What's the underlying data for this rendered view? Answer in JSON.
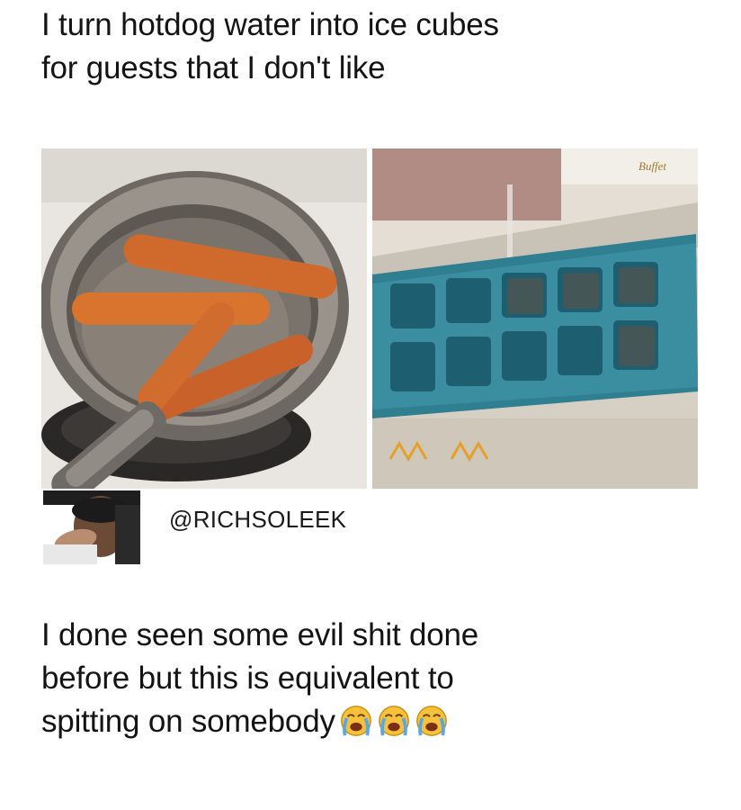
{
  "post": {
    "caption_lines": [
      "I turn hotdog water into ice cubes",
      "for guests that I don't like"
    ]
  },
  "reply": {
    "handle": "@RICHSOLEEK",
    "text_lines": [
      "I done seen some evil shit done",
      "before but this is equivalent to",
      "spitting on somebody"
    ],
    "emoji": [
      "loudly-crying-face-icon",
      "loudly-crying-face-icon",
      "loudly-crying-face-icon"
    ]
  },
  "photo_right": {
    "box_text": "Buffet"
  }
}
